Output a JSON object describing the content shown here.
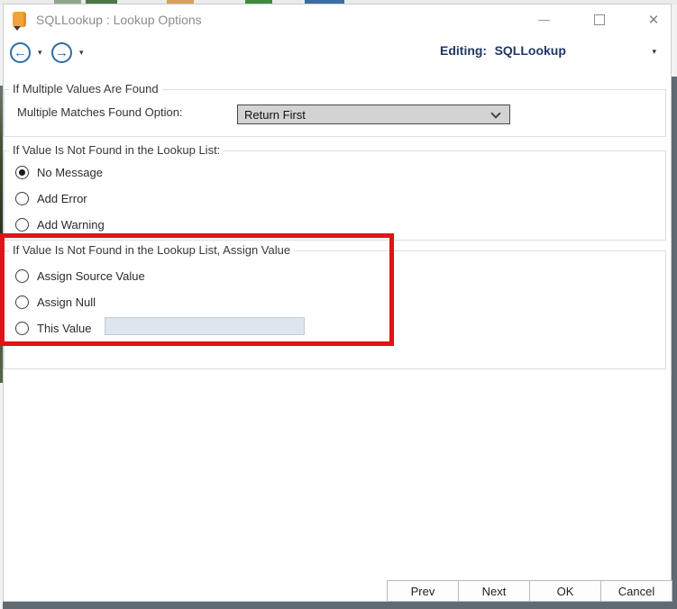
{
  "window": {
    "title": "SQLLookup : Lookup Options"
  },
  "icons": {
    "app": "lookup-database-icon",
    "back_arrow": "←",
    "forward_arrow": "→",
    "caret_down": "▾",
    "close": "×"
  },
  "toolbar": {
    "editing_label": "Editing:",
    "editing_value": "SQLLookup"
  },
  "sections": {
    "multiple_values": {
      "title": "If Multiple Values Are Found",
      "field_label": "Multiple Matches Found Option:",
      "dropdown_value": "Return First"
    },
    "not_found_message": {
      "title": "If Value Is Not Found in the Lookup List:",
      "options": [
        "No Message",
        "Add Error",
        "Add Warning"
      ],
      "selected": "No Message"
    },
    "not_found_assign": {
      "title": "If Value Is Not Found in the Lookup List, Assign Value",
      "options": [
        "Assign Source Value",
        "Assign Null",
        "This Value"
      ],
      "selected": "",
      "this_value": ""
    }
  },
  "footer": {
    "buttons": [
      "Prev",
      "Next",
      "OK",
      "Cancel"
    ]
  },
  "colors": {
    "accent_blue": "#2e6da4",
    "editing_text": "#1f3864",
    "highlight_red": "#df1418",
    "window_edge": "#5f6a73",
    "dropdown_bg": "#d3d3d3",
    "input_bg": "#dde5ee"
  }
}
